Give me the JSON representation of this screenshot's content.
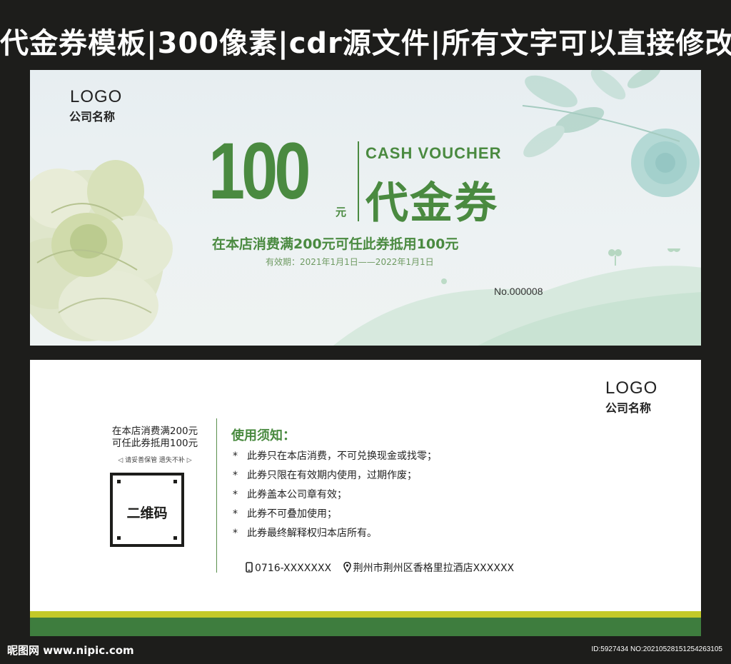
{
  "header": {
    "title": "代金券模板|300像素|cdr源文件|所有文字可以直接修改"
  },
  "front": {
    "logo": "LOGO",
    "company": "公司名称",
    "amount": "100",
    "unit": "元",
    "cash_voucher": "CASH VOUCHER",
    "voucher_cn": "代金券",
    "condition": "在本店消费满200元可任此券抵用100元",
    "validity": "有效期：2021年1月1日——2022年1月1日",
    "serial": "No.000008"
  },
  "back": {
    "logo": "LOGO",
    "company": "公司名称",
    "condition_line1": "在本店消费满200元",
    "condition_line2": "可任此券抵用100元",
    "keep_note": "◁ 请妥善保管  遗失不补 ▷",
    "qr_label": "二维码",
    "usage_title": "使用须知：",
    "usage_items": [
      "此券只在本店消费，不可兑换现金或找零；",
      "此券只限在有效期内使用，过期作废；",
      "此券盖本公司章有效；",
      "此券不可叠加使用；",
      "此券最终解释权归本店所有。"
    ],
    "bullet": "*",
    "phone": "0716-XXXXXXX",
    "address": "荆州市荆州区香格里拉酒店XXXXXX",
    "phone_icon": "phone-icon",
    "location_icon": "location-pin-icon"
  },
  "footer": {
    "watermark": "昵图网 www.nipic.com",
    "id_text": "ID:5927434 NO:20210528151254263105"
  },
  "colors": {
    "brand_green": "#4a8a40",
    "band_gold": "#c3c928",
    "band_green": "#3e7d3e",
    "frame": "#1d1d1b"
  }
}
